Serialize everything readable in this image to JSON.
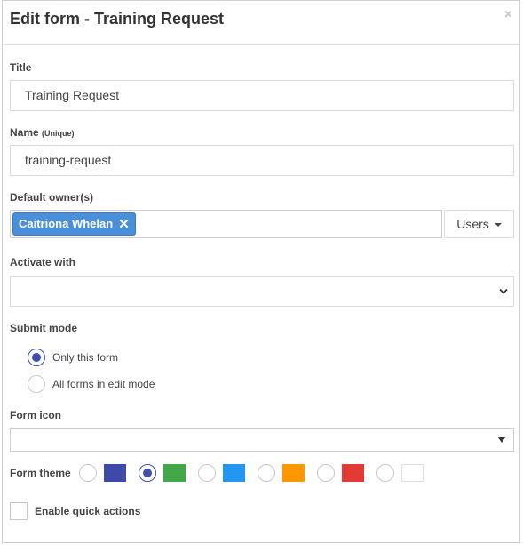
{
  "modal": {
    "title": "Edit form - Training Request",
    "close_glyph": "×"
  },
  "fields": {
    "title": {
      "label": "Title",
      "value": "Training Request"
    },
    "name": {
      "label": "Name",
      "label_note": "(Unique)",
      "value": "training-request"
    },
    "owners": {
      "label": "Default owner(s)",
      "tags": [
        "Caitriona Whelan"
      ],
      "remove_glyph": "✕",
      "users_button": "Users"
    },
    "activate_with": {
      "label": "Activate with",
      "value": ""
    },
    "submit_mode": {
      "label": "Submit mode",
      "options": [
        {
          "label": "Only this form",
          "checked": true
        },
        {
          "label": "All forms in edit mode",
          "checked": false
        }
      ]
    },
    "form_icon": {
      "label": "Form icon",
      "value": ""
    },
    "form_theme": {
      "label": "Form theme",
      "selected_index": 1,
      "colors": [
        "#3d4aa8",
        "#43a84a",
        "#2196f3",
        "#ff9800",
        "#e53935",
        "#ffffff"
      ]
    },
    "quick_actions": {
      "label": "Enable quick actions",
      "checked": false
    }
  }
}
